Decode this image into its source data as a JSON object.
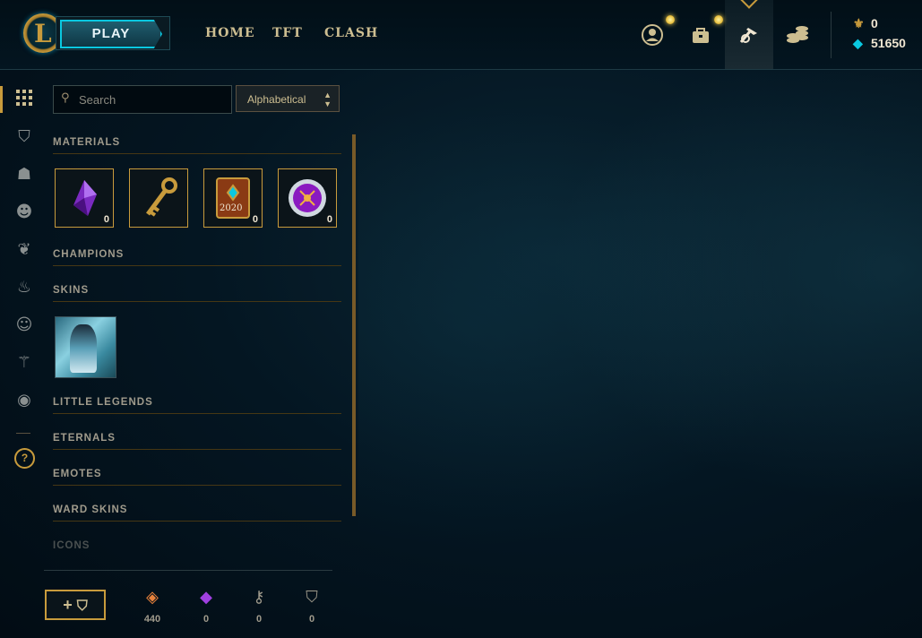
{
  "header": {
    "play_label": "PLAY",
    "nav": [
      "HOME",
      "TFT",
      "CLASH"
    ],
    "icons": [
      "profile-icon",
      "collection-icon",
      "loot-icon",
      "store-icon"
    ],
    "currencies": [
      {
        "name": "riot-points-icon",
        "value": "0",
        "color": "#c89b3c"
      },
      {
        "name": "blue-essence-icon",
        "value": "51650",
        "color": "#0ac8e0"
      }
    ]
  },
  "sidebar": {
    "items": [
      "all-loot-icon",
      "chest-icon",
      "champions-icon",
      "skins-icon",
      "little-legends-icon",
      "eternals-icon",
      "emotes-icon",
      "ward-skins-icon",
      "icons-icon"
    ],
    "help_label": "?"
  },
  "filters": {
    "search_placeholder": "Search",
    "sort_value": "Alphabetical"
  },
  "sections": {
    "materials": "MATERIALS",
    "champions": "CHAMPIONS",
    "skins": "SKINS",
    "little_legends": "LITTLE LEGENDS",
    "eternals": "ETERNALS",
    "emotes": "EMOTES",
    "ward_skins": "WARD SKINS",
    "icons": "ICONS"
  },
  "materials": [
    {
      "name": "gemstone",
      "count": "0"
    },
    {
      "name": "hextech-key",
      "count": ""
    },
    {
      "name": "2020-event-pass",
      "count": "0",
      "label": "2020"
    },
    {
      "name": "orb",
      "count": "0"
    }
  ],
  "footer": {
    "craft_label": "+",
    "wallet": [
      {
        "name": "orange-essence-icon",
        "value": "440",
        "color": "#e8823c"
      },
      {
        "name": "gemstone-icon",
        "value": "0",
        "color": "#a040e0"
      },
      {
        "name": "key-fragment-icon",
        "value": "0",
        "color": "#a09b8c"
      },
      {
        "name": "chest-icon",
        "value": "0",
        "color": "#a09b8c"
      }
    ]
  }
}
